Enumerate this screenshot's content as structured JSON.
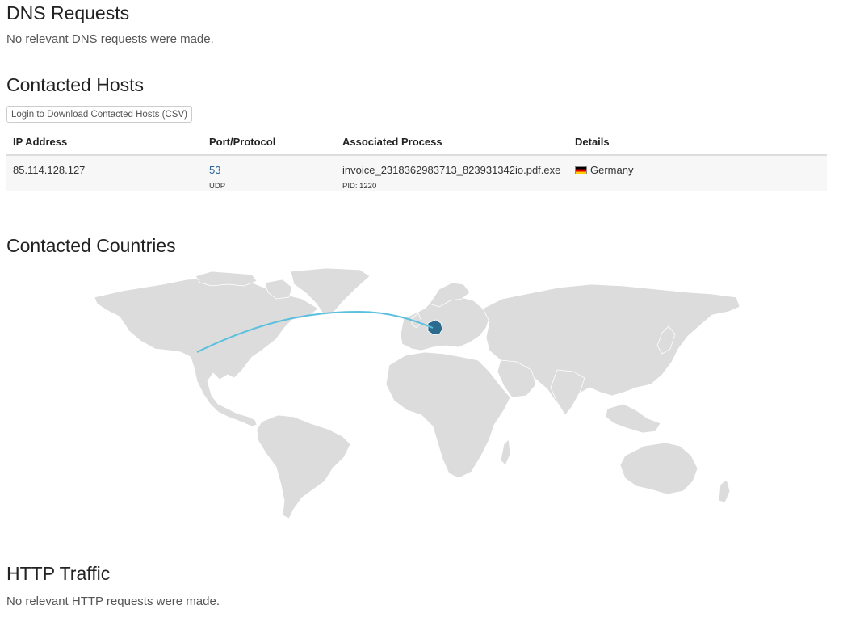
{
  "dns": {
    "title": "DNS Requests",
    "note": "No relevant DNS requests were made."
  },
  "hosts": {
    "title": "Contacted Hosts",
    "download_label": "Login to Download Contacted Hosts (CSV)",
    "columns": [
      "IP Address",
      "Port/Protocol",
      "Associated Process",
      "Details"
    ],
    "rows": [
      {
        "ip": "85.114.128.127",
        "port": "53",
        "protocol": "UDP",
        "process": "invoice_2318362983713_823931342io.pdf.exe",
        "pid": "PID: 1220",
        "country": "Germany",
        "flag_icon": "germany-flag-icon"
      }
    ]
  },
  "countries": {
    "title": "Contacted Countries",
    "highlight_color": "#2d6b8e",
    "land_color": "#dcdcdc",
    "arc_color": "#5bc0de"
  },
  "http": {
    "title": "HTTP Traffic",
    "note": "No relevant HTTP requests were made."
  }
}
